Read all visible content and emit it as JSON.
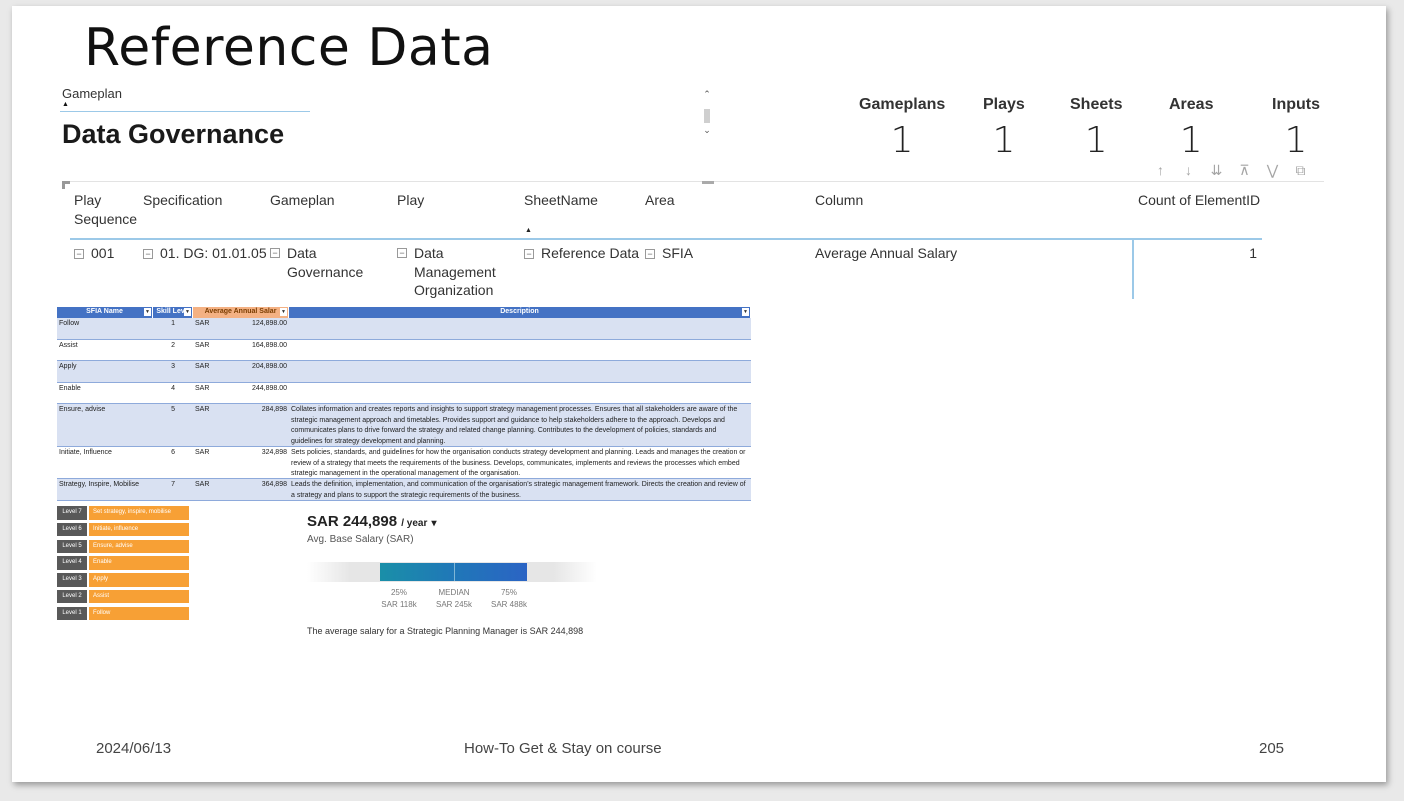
{
  "slide": {
    "title": "Reference Data"
  },
  "slicer": {
    "label": "Gameplan",
    "value": "Data Governance"
  },
  "cards": [
    {
      "label": "Gameplans",
      "value": "1"
    },
    {
      "label": "Plays",
      "value": "1"
    },
    {
      "label": "Sheets",
      "value": "1"
    },
    {
      "label": "Areas",
      "value": "1"
    },
    {
      "label": "Inputs",
      "value": "1"
    }
  ],
  "toolbar_icons": [
    "arrow-up-icon",
    "arrow-down-icon",
    "expand-down-icon",
    "hierarchy-icon",
    "filter-icon",
    "focus-mode-icon"
  ],
  "matrix": {
    "headers": [
      "Play Sequence",
      "Specification",
      "Gameplan",
      "Play",
      "SheetName",
      "Area",
      "Column",
      "Count of ElementID"
    ],
    "row": {
      "sequence": "001",
      "specification": "01. DG: 01.01.05",
      "gameplan": "Data Governance",
      "play": "Data Management Organization",
      "sheetname": "Reference Data",
      "area": "SFIA",
      "column": "Average Annual Salary",
      "count": "1"
    }
  },
  "excel": {
    "headers": [
      "SFIA Name",
      "Skill Leve",
      "Average Annual Salar",
      "Description"
    ],
    "rows": [
      {
        "name": "Follow",
        "level": "1",
        "cur": "SAR",
        "amount": "124,898.00",
        "desc": ""
      },
      {
        "name": "Assist",
        "level": "2",
        "cur": "SAR",
        "amount": "164,898.00",
        "desc": ""
      },
      {
        "name": "Apply",
        "level": "3",
        "cur": "SAR",
        "amount": "204,898.00",
        "desc": ""
      },
      {
        "name": "Enable",
        "level": "4",
        "cur": "SAR",
        "amount": "244,898.00",
        "desc": ""
      },
      {
        "name": "Ensure, advise",
        "level": "5",
        "cur": "SAR",
        "amount": "284,898",
        "desc": "Collates information and creates reports and insights to support strategy management processes. Ensures that all stakeholders are aware of the strategic management approach and timetables. Provides support and guidance to help stakeholders adhere to the approach. Develops and communicates plans to drive forward the strategy and related change planning. Contributes to the development of policies, standards and guidelines for strategy development and planning."
      },
      {
        "name": "Initiate, Influence",
        "level": "6",
        "cur": "SAR",
        "amount": "324,898",
        "desc": "Sets policies, standards, and guidelines for how the organisation conducts strategy development and planning. Leads and manages the creation or review of a strategy that meets the requirements of the business. Develops, communicates, implements and reviews the processes which embed strategic management in the operational management of the organisation."
      },
      {
        "name": "Strategy, Inspire, Mobilise",
        "level": "7",
        "cur": "SAR",
        "amount": "364,898",
        "desc": "Leads the definition, implementation, and communication of the organisation's strategic management framework. Directs the creation and review of a strategy and plans to support the strategic requirements of the business."
      }
    ]
  },
  "ladder": [
    {
      "level": "Level 7",
      "text": "Set strategy, inspire, mobilise"
    },
    {
      "level": "Level 6",
      "text": "Initiate, influence"
    },
    {
      "level": "Level 5",
      "text": "Ensure, advise"
    },
    {
      "level": "Level 4",
      "text": "Enable"
    },
    {
      "level": "Level 3",
      "text": "Apply"
    },
    {
      "level": "Level 2",
      "text": "Assist"
    },
    {
      "level": "Level 1",
      "text": "Follow"
    }
  ],
  "salary": {
    "amount": "SAR 244,898",
    "period": "/ year",
    "subtitle": "Avg. Base Salary (SAR)",
    "p25_label": "25%",
    "p25_value": "SAR 118k",
    "median_label": "MEDIAN",
    "median_value": "SAR 245k",
    "p75_label": "75%",
    "p75_value": "SAR 488k",
    "note": "The average salary for a Strategic Planning Manager is SAR 244,898"
  },
  "footer": {
    "date": "2024/06/13",
    "center": "How-To Get & Stay on course",
    "page": "205"
  }
}
